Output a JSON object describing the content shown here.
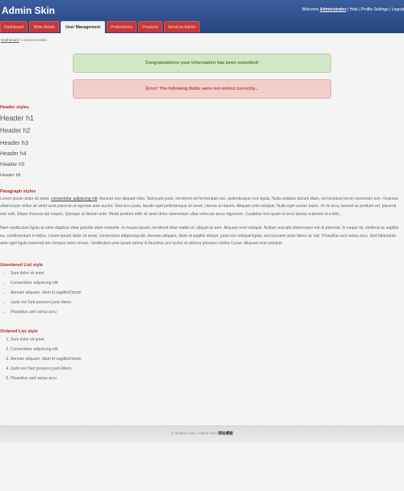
{
  "header": {
    "title": "Admin Skin",
    "welcome_prefix": "Welcome",
    "username": "Administrator",
    "nav_tail": " | Help | Profile Settings | Logout"
  },
  "tabs": [
    {
      "label": "Dashboard"
    },
    {
      "label": "Write Article"
    },
    {
      "label": "User Management"
    },
    {
      "label": "Preferences"
    },
    {
      "label": "Products"
    },
    {
      "label": "Services Admin"
    }
  ],
  "breadcrumb": {
    "home": "Dashboard",
    "separator": " > ",
    "current": "Current Article"
  },
  "messages": {
    "success": "Congratulations your information has been submited!",
    "error": "Error! The following fields were not entred correctly..."
  },
  "headers_section": {
    "title": "Header styles",
    "h1": "Header h1",
    "h2": "Header h2",
    "h3": "Header h3",
    "h4": "Header h4",
    "h5": "Header h5",
    "h6": "Header h6"
  },
  "paragraph_section": {
    "title": "Paragraph styles",
    "p1_start": "Lorem ipsum dolor sit amet, ",
    "p1_link": "consectetur adipiscing elit",
    "p1_rest": ". Aenean non aliquam felis. Sed justo justo, hendrerit vel fermentum nec, pellentesque non ligula. Nulla sodales dictum diam, vel tincidunt lorem commodo non. Vivamus ullamcorper tellus sit amet urna placerat ut egestas ante auctor. Sed arcu justo, iaculis eget pellentesque sit amet, viverra ut mauris. Aliquam erat volutpat. Nulla eget auctor turpis. Ut mi arcu, laoreet ac pretium vel, placerat non velit. Etiam rhoncus dui mauris. Quisque ut dictum ante. Morbi pretium nibh sit amet dolor elementum vitae vehicula lacus dignissim. Curabitur non quam et eros lacinia euismod id a felis.",
    "p2": "Nam vestibulum ligula at enim dapibus vitae gravida diam molestie. In mauris ipsum, hendrerit vitae mattis et, aliquet at sem. Aliquam erat volutpat. Nullam suscipit ullamcorper est at placerat. In neque mi, eleifend ac sagittis eu, condimentum in tellus. Lorem ipsum dolor sit amet, consectetur adipiscing elit. Aenean aliquam, diam id sagittis dictum, justo est volutpat ligula, sed posuere justo libero ac nisl. Phasellus sed varius arcu. Sed bibendum ante eget ligula euismod nec tempus enim ornare. Vestibulum ante ipsum primis in faucibus orci luctus et ultrices posuere cubilia Curae; Aliquam erat volutpat."
  },
  "unordered_section": {
    "title": "Unordered List style",
    "items": [
      "Sum dolor sit amet",
      "Consectetur adipiscing elit",
      "Aenean aliquam, diam id sagittisDictum",
      "Justo est Sed posuere justo libero",
      "Phasellus sed varius arcu"
    ]
  },
  "ordered_section": {
    "title": "Ordered List style",
    "items": [
      "Sum dolor sit amet",
      "Consectetur adipiscing elit",
      "Aenean aliquam, diam id sagittisDictum",
      "Justo est Sed posuere justo libero",
      "Phasellus sed varius arcu"
    ]
  },
  "footer": {
    "text": "© Sinome.com. Collect from ",
    "brand": "网站模板"
  }
}
